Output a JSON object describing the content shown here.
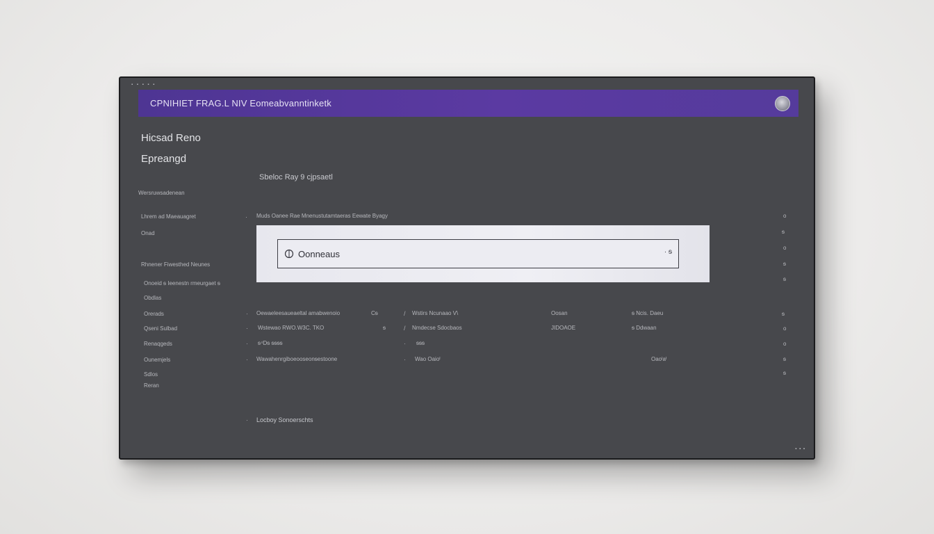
{
  "window": {
    "top_marks": "▪ ▪ ▪ ▪ ▪",
    "title": "CPNIHIET FRAG.L NIV Eomeabvanntinketk",
    "corner_marks": "▪ ▪ ▪"
  },
  "sidebar": {
    "heading": "Hicsad Reno",
    "subheading": "Epreangd",
    "section_label": "Wersruwsadenean",
    "items": [
      {
        "label": "Lhrem ad Maeauagret"
      },
      {
        "label": "Onad"
      },
      {
        "label": "Rhnener Fiwesthed Neunes"
      },
      {
        "label": "Onoeid ᵴ Ieenestn rmeurgaet ᵴ"
      },
      {
        "label": "Obdlas"
      },
      {
        "label": "Orerads"
      },
      {
        "label": "Qseni Sulbad"
      },
      {
        "label": "Renaqgeds"
      },
      {
        "label": "Ounemjels"
      },
      {
        "label": "Sdlos"
      },
      {
        "label": "Reran"
      }
    ]
  },
  "main": {
    "section_title": "Sbeloc Ray 9 cjpsaetl",
    "search_label": "Muds Oanee Rae Mnenustutamtaeras Eewate Byagy",
    "search": {
      "placeholder": "Oonneaus",
      "end_glyph": "· ᵴ"
    },
    "table": {
      "rows": [
        {
          "c1": "Oewaeleesaueaeltal amabwenoio",
          "c1b": "Cᵴ",
          "c2": "Wstirs Ncunaao V\\",
          "c3": "Oosan",
          "c4": "ᵴ Ncis. Daeu"
        },
        {
          "c1": "Wstewao RWO.W3C. TKO",
          "c1b": "ᵴ",
          "c2": "Nmdecse Sdocbaos",
          "c3": "JIDOAOE",
          "c4": "ᵴ Ddwaan"
        },
        {
          "c1": "ᵴ⁴Dᵴ ᵴᵴᵴᵴ",
          "c1b": "",
          "c2": "ᵴᵴᵴ",
          "c3": "",
          "c4": ""
        },
        {
          "c1": "Wawahenrgiboeooseonᵴestoone",
          "c1b": "",
          "c2": "Wao Oaioᴵ",
          "c3": "",
          "c4": "Oaoᴵaᴵ"
        }
      ]
    },
    "footer_link": "Locboy Sonoerschts"
  },
  "right_column": {
    "marks": [
      "o",
      "ᵴ",
      "o",
      "ᵴ",
      "ᵴ",
      "ᵴ",
      "o",
      "o",
      "ᵴ",
      "ᵴ",
      "o"
    ]
  },
  "colors": {
    "titlebar": "#553b9c",
    "panel": "#47484c",
    "search_panel": "#ececf2"
  }
}
